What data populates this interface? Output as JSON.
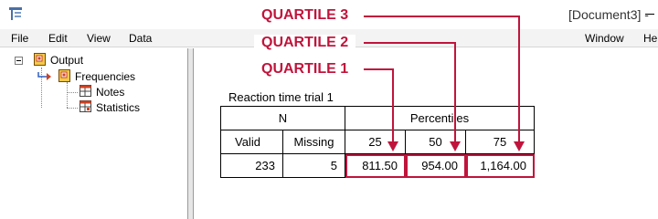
{
  "window": {
    "document_title": "[Document3] -"
  },
  "menu": {
    "file": "File",
    "edit": "Edit",
    "view": "View",
    "data": "Data",
    "window": "Window",
    "help": "He"
  },
  "outline": {
    "root": "Output",
    "frequencies": "Frequencies",
    "notes": "Notes",
    "statistics": "Statistics"
  },
  "table": {
    "title": "Reaction time trial 1",
    "header_n": "N",
    "header_percentiles": "Percentiles",
    "col_valid": "Valid",
    "col_missing": "Missing",
    "col_p25": "25",
    "col_p50": "50",
    "col_p75": "75",
    "val_valid": "233",
    "val_missing": "5",
    "val_p25": "811.50",
    "val_p50": "954.00",
    "val_p75": "1,164.00"
  },
  "callouts": {
    "q3": "QUARTILE 3",
    "q2": "QUARTILE 2",
    "q1": "QUARTILE 1"
  },
  "colors": {
    "accent": "#c0143c",
    "icon_red": "#d04020",
    "icon_yellow": "#f2c94c"
  }
}
